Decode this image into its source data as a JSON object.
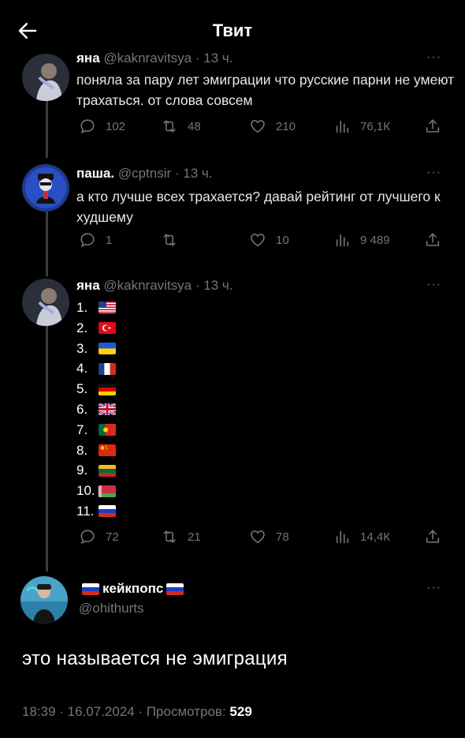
{
  "header": {
    "title": "Твит"
  },
  "thread": [
    {
      "name": "яна",
      "handle": "@kaknravitsya",
      "time": "· 13 ч.",
      "text": "поняла за пару лет эмиграции что русские парни не умеют трахаться. от слова совсем",
      "replies": "102",
      "retweets": "48",
      "likes": "210",
      "views": "76,1К"
    },
    {
      "name": "паша.",
      "handle": "@cptnsir",
      "time": "· 13 ч.",
      "text": "а кто лучше всех трахается? давай рейтинг от лучшего к худшему",
      "replies": "1",
      "retweets": "",
      "likes": "10",
      "views": "9 489"
    },
    {
      "name": "яна",
      "handle": "@kaknravitsya",
      "time": "· 13 ч.",
      "ranking": [
        {
          "n": "1.",
          "flag": "us"
        },
        {
          "n": "2.",
          "flag": "tr"
        },
        {
          "n": "3.",
          "flag": "ua"
        },
        {
          "n": "4.",
          "flag": "fr"
        },
        {
          "n": "5.",
          "flag": "de"
        },
        {
          "n": "6.",
          "flag": "gb"
        },
        {
          "n": "7.",
          "flag": "pt"
        },
        {
          "n": "8.",
          "flag": "cn"
        },
        {
          "n": "9.",
          "flag": "lt"
        },
        {
          "n": "10.",
          "flag": "by"
        },
        {
          "n": "11.",
          "flag": "ru"
        }
      ],
      "replies": "72",
      "retweets": "21",
      "likes": "78",
      "views": "14,4К"
    }
  ],
  "main_tweet": {
    "name": "кейкпопс",
    "name_flags": [
      "ru",
      "ru"
    ],
    "handle": "@ohithurts",
    "text": "это называется не эмиграция",
    "meta": "18:39 · 16.07.2024 · Просмотров:",
    "views": "529"
  },
  "more_label": "···",
  "icons": {
    "back": "arrow-left-icon",
    "reply": "reply-icon",
    "retweet": "retweet-icon",
    "like": "heart-icon",
    "views": "views-icon",
    "share": "share-icon",
    "more": "more-icon"
  },
  "colors": {
    "background": "#000000",
    "text": "#e7e9ea",
    "muted": "#71767b",
    "thread_line": "#3a3d40"
  }
}
